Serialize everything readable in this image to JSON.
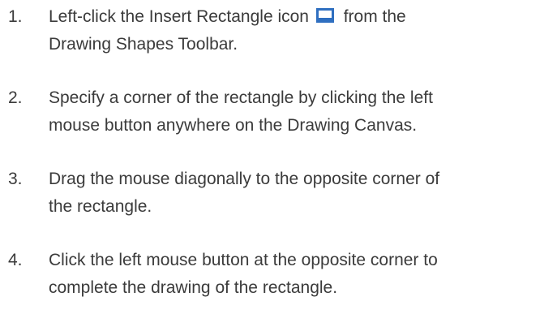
{
  "steps": [
    {
      "number": "1.",
      "text_before_icon": "Left-click the Insert Rectangle icon",
      "icon": "rectangle-tool-icon",
      "text_after_icon": "from the",
      "line2": "Drawing Shapes Toolbar."
    },
    {
      "number": "2.",
      "line1": "Specify a corner of the rectangle by clicking the left",
      "line2": "mouse button anywhere on the Drawing Canvas."
    },
    {
      "number": "3.",
      "line1": "Drag the mouse diagonally to the opposite corner of",
      "line2": "the rectangle."
    },
    {
      "number": "4.",
      "line1": "Click the left mouse button at the opposite corner to",
      "line2": "complete the drawing of the rectangle."
    }
  ],
  "colors": {
    "text": "#3b3b3b",
    "icon_fill": "#2f6fc0",
    "icon_inner": "#ffffff"
  }
}
